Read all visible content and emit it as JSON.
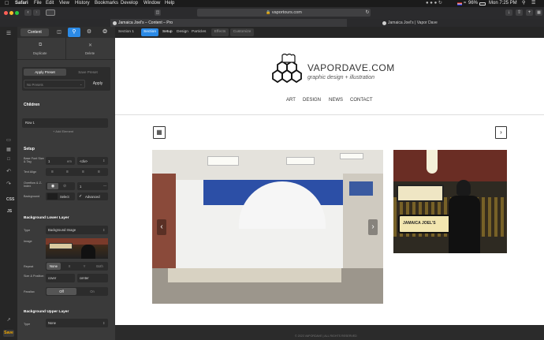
{
  "menubar": {
    "apple": "",
    "items": [
      "Safari",
      "File",
      "Edit",
      "View",
      "History",
      "Bookmarks",
      "Develop",
      "Window",
      "Help"
    ],
    "battery": "96%",
    "clock": "Mon 7:25 PM"
  },
  "browser": {
    "address": "vaportours.com",
    "tabs": [
      {
        "label": "Jamaica Joel's – Content – Pro"
      },
      {
        "label": "Jamaica Joel's | Vapor Dave"
      }
    ]
  },
  "builder": {
    "toolbar": {
      "content_tab": "Content"
    },
    "duplicate_label": "Duplicate",
    "delete_label": "Delete",
    "apply_preset": "Apply Preset",
    "save_preset": "Save Preset",
    "presets_placeholder": "No Presets",
    "apply": "Apply",
    "children_heading": "Children",
    "row_label": "Row 1",
    "add_element": "+ Add Element",
    "setup_heading": "Setup",
    "base_font_label": "Base Font Size & Tag",
    "base_font_value": "1",
    "base_font_unit": "em",
    "tag_value": "<div>",
    "text_align_label": "Text Align",
    "overflow_label": "Overflow & Z-Index",
    "z_index_value": "1",
    "background_label": "Background",
    "select_label": "Select",
    "advanced_label": "Advanced",
    "lower_layer_heading": "Background Lower Layer",
    "type_label": "Type",
    "type_value": "Background Image",
    "image_label": "Image",
    "repeat_label": "Repeat",
    "repeat_options": [
      "None",
      "X",
      "Y",
      "Both"
    ],
    "size_position_label": "Size & Position",
    "size_value": "cover",
    "position_value": "center",
    "parallax_label": "Parallax",
    "parallax_off": "Off",
    "parallax_on": "On",
    "upper_layer_heading": "Background Upper Layer",
    "upper_type_label": "Type",
    "upper_type_value": "None"
  },
  "rail": {
    "css_label": "CSS",
    "js_label": "JS",
    "save_label": "Save"
  },
  "breadcrumbs": {
    "section": "Section 1",
    "tabs": [
      "Section",
      "Setup",
      "Design",
      "Particles",
      "Effects",
      "Customize"
    ]
  },
  "site": {
    "logo_main": "VAPORDAVE.COM",
    "logo_tag": "graphic design + illustration",
    "nav": [
      "ART",
      "DESIGN",
      "NEWS",
      "CONTACT"
    ],
    "footer": "© 2023 VAPORDAVE | ALL RIGHTS RESERVED",
    "poster_text": "JAMAICA JOEL'S"
  },
  "colors": {
    "accent": "#2b8ae6",
    "save": "#f0a800",
    "panel": "#3a3a3a",
    "footer": "#2b2b2b"
  }
}
